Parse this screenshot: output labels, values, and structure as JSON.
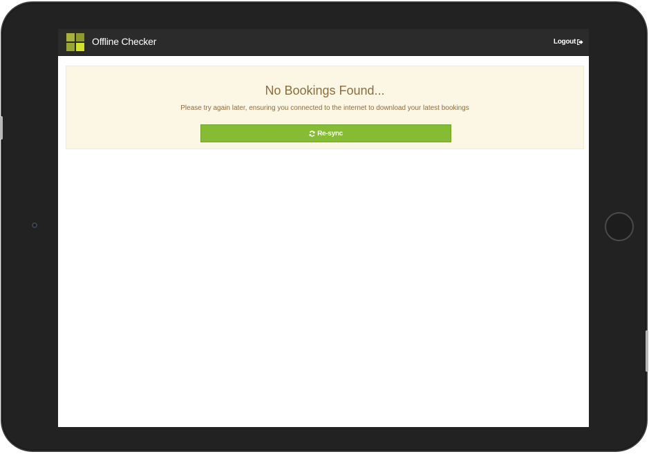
{
  "app": {
    "title": "Offline Checker",
    "logo_colors": [
      "#a8b13a",
      "#8e9a2a",
      "#9aa634",
      "#d6e12a"
    ]
  },
  "navbar": {
    "logout_label": "Logout",
    "logout_icon": "sign-out-icon"
  },
  "alert": {
    "title": "No Bookings Found...",
    "message": "Please try again later, ensuring you connected to the internet to download your latest bookings",
    "resync_label": "Re-sync",
    "resync_icon": "refresh-icon"
  },
  "colors": {
    "navbar_bg": "#2b2b2b",
    "alert_bg": "#fcf7e4",
    "alert_text": "#8a6d3b",
    "button_bg": "#84bd31"
  }
}
